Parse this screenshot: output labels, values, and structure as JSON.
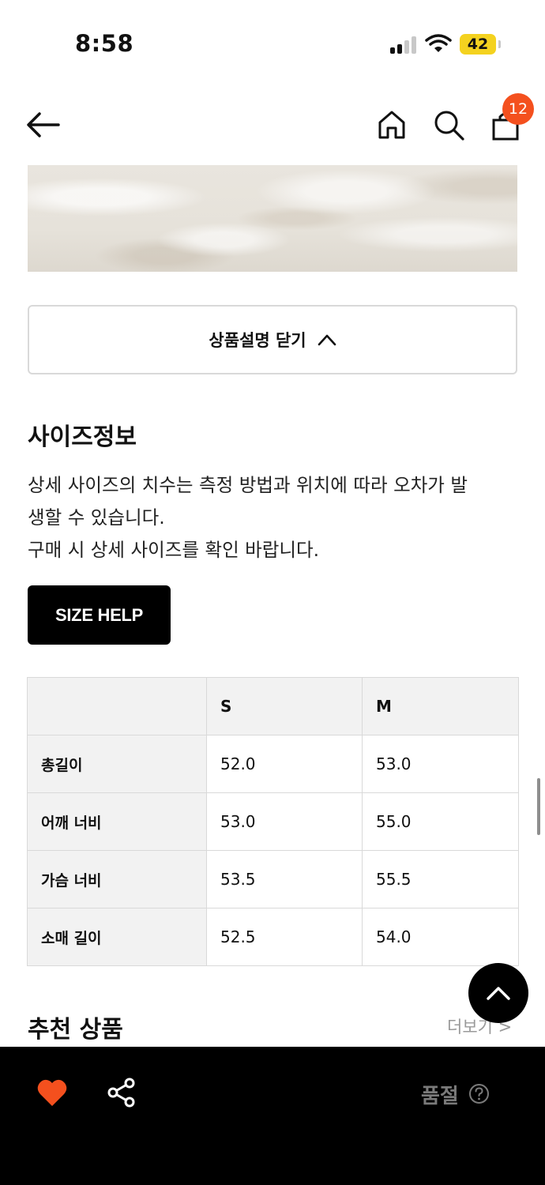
{
  "status_bar": {
    "time": "8:58",
    "battery": "42",
    "battery_color": "#f4d21f"
  },
  "header": {
    "back_icon": "arrow-left-icon",
    "home_icon": "home-icon",
    "search_icon": "search-icon",
    "bag_icon": "shopping-bag-icon",
    "cart_count": "12",
    "badge_color": "#f4501e"
  },
  "description": {
    "collapse_label": "상품설명 닫기"
  },
  "size_info": {
    "title": "사이즈정보",
    "desc_lines": [
      "상세 사이즈의 치수는 측정 방법과 위치에 따라 오차가 발",
      "생할 수 있습니다.",
      "구매 시 상세 사이즈를 확인 바랍니다."
    ],
    "size_help_label": "SIZE HELP",
    "table": {
      "columns": [
        "",
        "S",
        "M"
      ],
      "rows": [
        {
          "label": "총길이",
          "values": [
            "52.0",
            "53.0"
          ]
        },
        {
          "label": "어깨 너비",
          "values": [
            "53.0",
            "55.0"
          ]
        },
        {
          "label": "가슴 너비",
          "values": [
            "53.5",
            "55.5"
          ]
        },
        {
          "label": "소매 길이",
          "values": [
            "52.5",
            "54.0"
          ]
        }
      ]
    }
  },
  "recommended": {
    "title": "추천 상품",
    "more_label": "더보기 >"
  },
  "bottom_bar": {
    "heart_icon": "heart-icon",
    "heart_color": "#f4501e",
    "share_icon": "share-icon",
    "soldout_label": "품절",
    "help_icon": "question-circle-icon"
  }
}
